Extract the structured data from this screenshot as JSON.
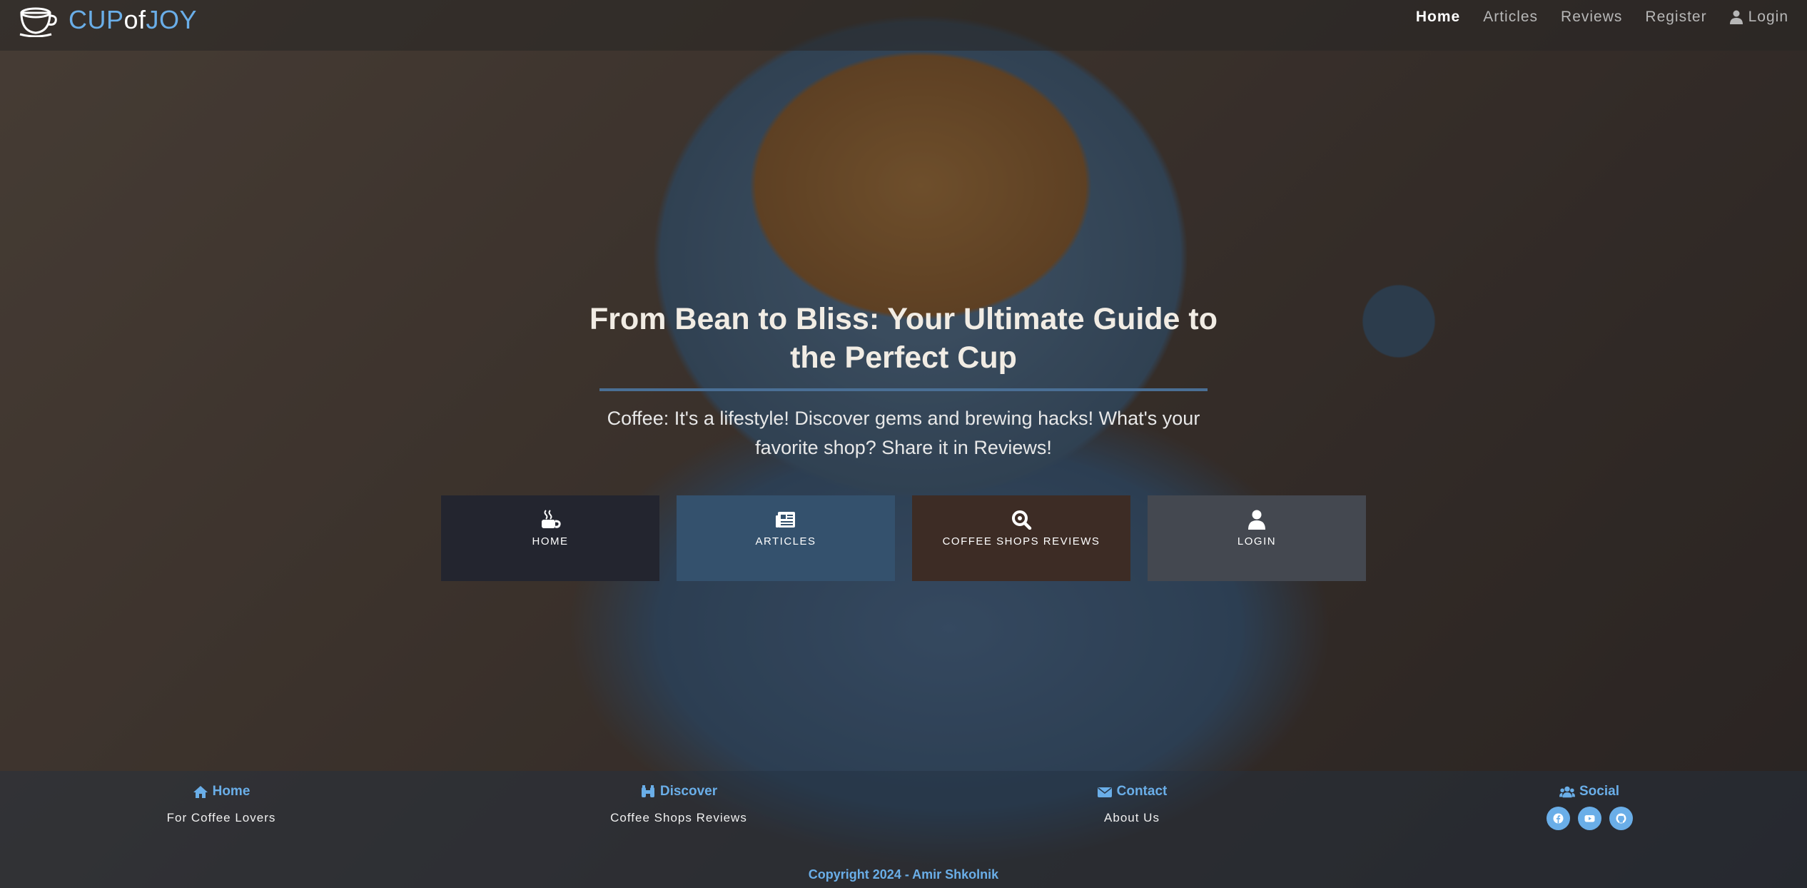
{
  "brand": {
    "part1": "CUP",
    "part2": "of",
    "part3": "JOY",
    "icon": "coffee-cup-icon"
  },
  "nav": {
    "home": "Home",
    "articles": "Articles",
    "reviews": "Reviews",
    "register": "Register",
    "login": "Login"
  },
  "hero": {
    "title": "From Bean to Bliss: Your Ultimate Guide to the Perfect Cup",
    "subtitle": "Coffee: It's a lifestyle! Discover gems and brewing hacks! What's your favorite shop? Share it in Reviews!"
  },
  "tiles": [
    {
      "label": "HOME",
      "icon": "mug-hot-icon"
    },
    {
      "label": "ARTICLES",
      "icon": "newspaper-icon"
    },
    {
      "label": "COFFEE SHOPS REVIEWS",
      "icon": "search-icon"
    },
    {
      "label": "LOGIN",
      "icon": "user-icon"
    }
  ],
  "footer": {
    "home": {
      "title": "Home",
      "link": "For Coffee Lovers"
    },
    "discover": {
      "title": "Discover",
      "link": "Coffee Shops Reviews"
    },
    "contact": {
      "title": "Contact",
      "link": "About Us"
    },
    "social": {
      "title": "Social",
      "icons": [
        "facebook-icon",
        "youtube-icon",
        "github-icon"
      ]
    },
    "copyright": "Copyright 2024 - Amir Shkolnik"
  },
  "colors": {
    "accent": "#6aaee8",
    "tile_home": "#23252f",
    "tile_articles": "#34516d",
    "tile_reviews": "#3d2c25",
    "tile_login": "#444850"
  }
}
